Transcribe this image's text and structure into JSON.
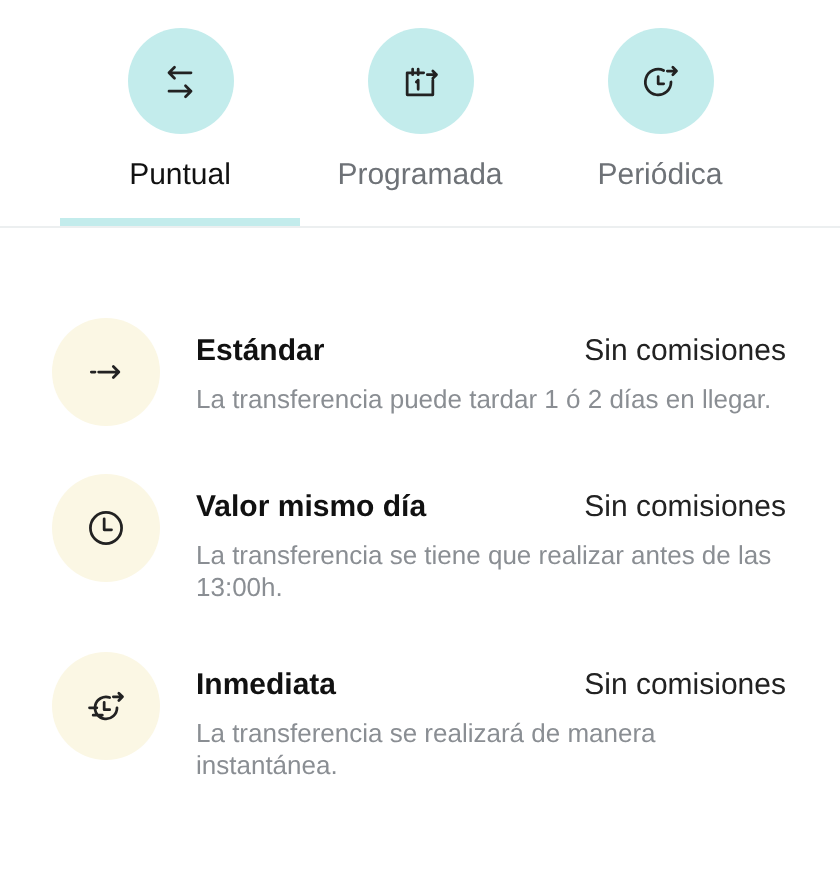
{
  "tabs": [
    {
      "label": "Puntual",
      "selected": true
    },
    {
      "label": "Programada",
      "selected": false
    },
    {
      "label": "Periódica",
      "selected": false
    }
  ],
  "options": [
    {
      "title": "Estándar",
      "fee": "Sin comisiones",
      "description": "La transferencia puede tardar 1 ó 2 días en llegar."
    },
    {
      "title": "Valor mismo día",
      "fee": "Sin comisiones",
      "description": "La transferencia se tiene que realizar antes de las 13:00h."
    },
    {
      "title": "Inmediata",
      "fee": "Sin comisiones",
      "description": "La transferencia se realizará de manera instantánea."
    }
  ]
}
